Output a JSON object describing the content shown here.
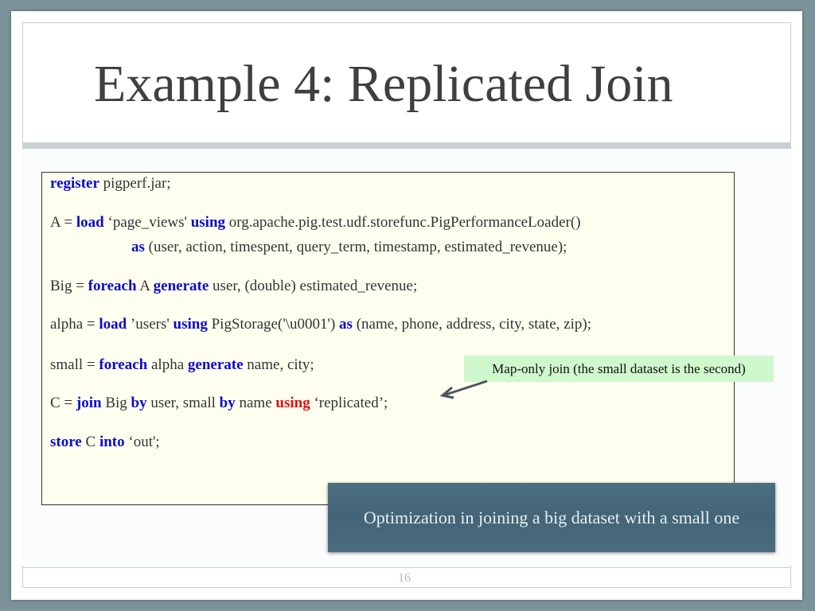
{
  "slide": {
    "title": "Example 4: Replicated Join",
    "code_lines": [
      [
        {
          "t": "register",
          "k": "kw"
        },
        {
          "t": " pigperf.jar;",
          "k": ""
        }
      ],
      [
        {
          "t": "A = ",
          "k": ""
        },
        {
          "t": "load",
          "k": "kw"
        },
        {
          "t": " ‘page_views' ",
          "k": ""
        },
        {
          "t": "using",
          "k": "kw"
        },
        {
          "t": " org.apache.pig.test.udf.storefunc.PigPerformanceLoader()",
          "k": ""
        }
      ],
      [
        {
          "t": "as",
          "k": "kw"
        },
        {
          "t": " (user, action, timespent, query_term, timestamp, estimated_revenue);",
          "k": ""
        }
      ],
      [
        {
          "t": "Big = ",
          "k": ""
        },
        {
          "t": "foreach",
          "k": "kw"
        },
        {
          "t": " A ",
          "k": ""
        },
        {
          "t": "generate",
          "k": "kw"
        },
        {
          "t": " user, (double) estimated_revenue;",
          "k": ""
        }
      ],
      [
        {
          "t": "alpha = ",
          "k": ""
        },
        {
          "t": "load",
          "k": "kw"
        },
        {
          "t": " ’users' ",
          "k": ""
        },
        {
          "t": "using",
          "k": "kw"
        },
        {
          "t": " PigStorage('\\u0001') ",
          "k": ""
        },
        {
          "t": "as",
          "k": "kw"
        },
        {
          "t": " (name, phone, address, city, state, zip);",
          "k": ""
        }
      ],
      [
        {
          "t": "small = ",
          "k": ""
        },
        {
          "t": "foreach",
          "k": "kw"
        },
        {
          "t": " alpha ",
          "k": ""
        },
        {
          "t": "generate",
          "k": "kw"
        },
        {
          "t": " name, city;",
          "k": ""
        }
      ],
      [
        {
          "t": "C = ",
          "k": ""
        },
        {
          "t": "join",
          "k": "kw"
        },
        {
          "t": " Big ",
          "k": ""
        },
        {
          "t": "by",
          "k": "kw"
        },
        {
          "t": " user, small ",
          "k": ""
        },
        {
          "t": "by",
          "k": "kw"
        },
        {
          "t": " name ",
          "k": ""
        },
        {
          "t": "using",
          "k": "red"
        },
        {
          "t": " ‘replicated’;",
          "k": ""
        }
      ],
      [
        {
          "t": "store",
          "k": "kw"
        },
        {
          "t": " C ",
          "k": ""
        },
        {
          "t": "into",
          "k": "kw"
        },
        {
          "t": " ‘out';",
          "k": ""
        }
      ]
    ],
    "callout": "Map-only join (the small dataset is the second)",
    "banner": "Optimization in joining a big dataset with a small one",
    "page_number": "16",
    "colors": {
      "keyword": "#0a0ad0",
      "highlight": "#e31010",
      "callout_bg": "#cff8cd",
      "banner_bg": "#456779"
    }
  }
}
